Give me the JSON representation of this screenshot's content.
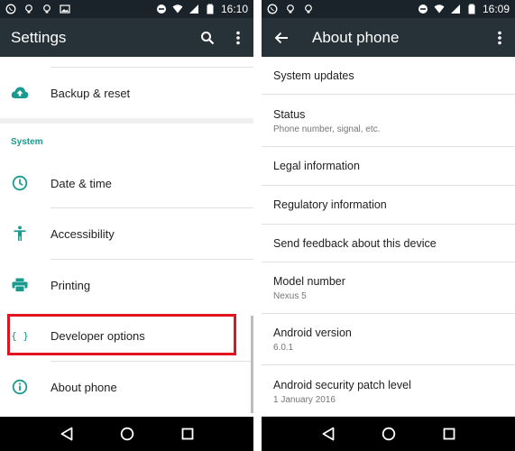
{
  "left": {
    "status_time": "16:10",
    "title": "Settings",
    "items_top": [
      {
        "label": "Backup & reset",
        "icon": "cloud-upload-icon"
      }
    ],
    "section_label": "System",
    "items": [
      {
        "label": "Date & time",
        "icon": "clock-icon"
      },
      {
        "label": "Accessibility",
        "icon": "accessibility-icon"
      },
      {
        "label": "Printing",
        "icon": "printer-icon"
      },
      {
        "label": "Developer options",
        "icon": "code-braces-icon"
      },
      {
        "label": "About phone",
        "icon": "info-icon"
      }
    ],
    "developer_icon_text": "{ }"
  },
  "right": {
    "status_time": "16:09",
    "title": "About phone",
    "items": [
      {
        "title": "System updates",
        "subtitle": ""
      },
      {
        "title": "Status",
        "subtitle": "Phone number, signal, etc."
      },
      {
        "title": "Legal information",
        "subtitle": ""
      },
      {
        "title": "Regulatory information",
        "subtitle": ""
      },
      {
        "title": "Send feedback about this device",
        "subtitle": ""
      },
      {
        "title": "Model number",
        "subtitle": "Nexus 5"
      },
      {
        "title": "Android version",
        "subtitle": "6.0.1"
      },
      {
        "title": "Android security patch level",
        "subtitle": "1 January 2016"
      }
    ]
  },
  "colors": {
    "appbar": "#263238",
    "statusbar": "#1a2329",
    "accent": "#199a8e",
    "highlight": "#e0141e"
  }
}
